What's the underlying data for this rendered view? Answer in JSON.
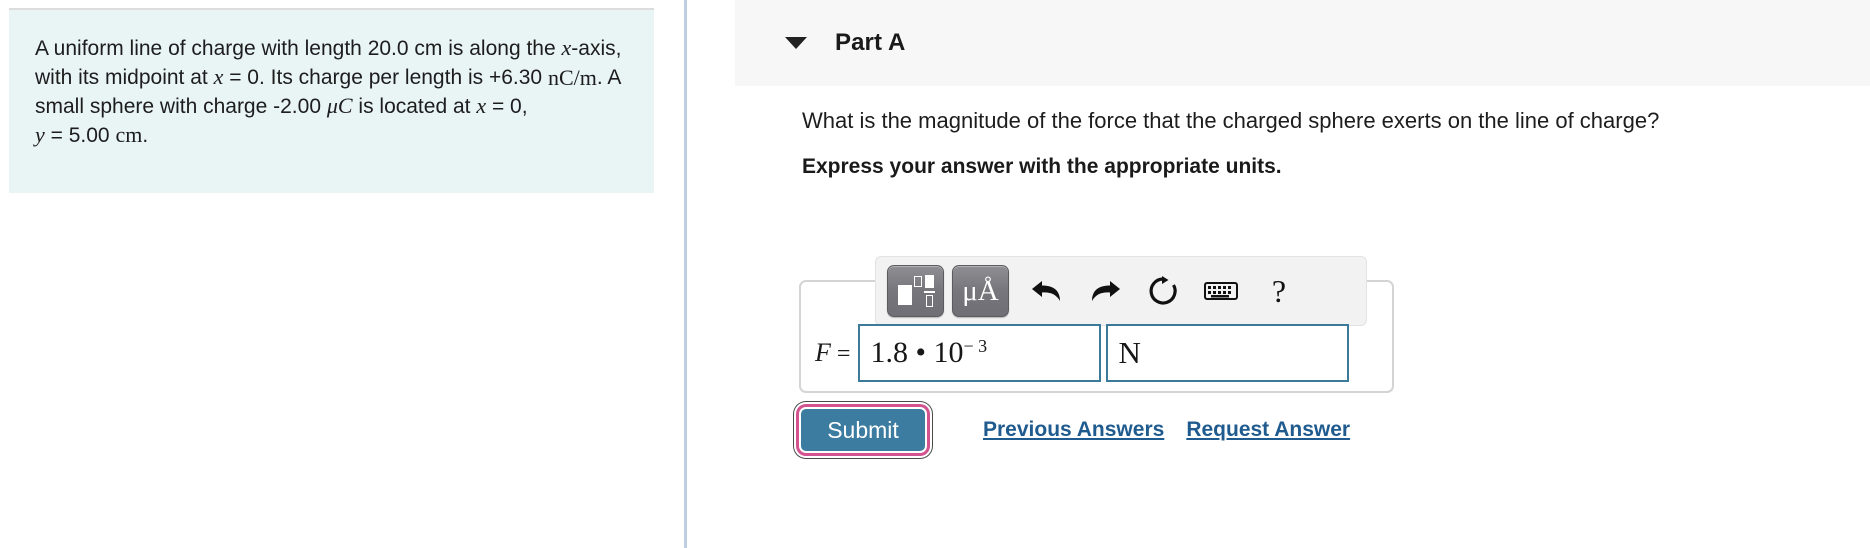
{
  "problem": {
    "segments": [
      {
        "t": "text",
        "v": "A uniform line of charge with length 20.0 cm is along the "
      },
      {
        "t": "math_i",
        "v": "x"
      },
      {
        "t": "text",
        "v": "-axis, with its midpoint at "
      },
      {
        "t": "math_i",
        "v": "x"
      },
      {
        "t": "text",
        "v": " = 0. Its charge per length is +6.30 "
      },
      {
        "t": "math_r",
        "v": "nC/m"
      },
      {
        "t": "text",
        "v": ". A small sphere with charge -2.00 "
      },
      {
        "t": "math_r",
        "v": "μC"
      },
      {
        "t": "text",
        "v": " is located at "
      },
      {
        "t": "math_i",
        "v": "x"
      },
      {
        "t": "text",
        "v": " = 0, "
      },
      {
        "t": "math_i",
        "v": "y"
      },
      {
        "t": "text",
        "v": " = 5.00 "
      },
      {
        "t": "math_r",
        "v": "cm"
      },
      {
        "t": "text",
        "v": "."
      }
    ],
    "plain": "A uniform line of charge with length 20.0 cm is along the x-axis, with its midpoint at x = 0. Its charge per length is +6.30 nC/m. A small sphere with charge -2.00 μC is located at x = 0, y = 5.00 cm.",
    "line1_a": "A uniform line of charge with length 20.0 cm",
    "line1_b": "is",
    "line2_a": "along the",
    "line2_x": "x",
    "line2_b": "-axis, with its midpoint at",
    "line2_x2": "x",
    "line2_c": "= 0. Its",
    "line3_a": "charge per length is +6.30",
    "line3_units": "nC/m",
    "line3_b": ". A small sphere",
    "line4_a": "with charge -2.00",
    "line4_units": "μC",
    "line4_b": "is located at",
    "line4_x": "x",
    "line4_c": "= 0,",
    "line5_y": "y",
    "line5_a": "= 5.00",
    "line5_units": "cm",
    "line5_b": "."
  },
  "part": {
    "title": "Part A",
    "collapse_icon": "caret-down-icon",
    "expanded": true
  },
  "question": {
    "prompt": "What is the magnitude of the force that the charged sphere exerts on the line of charge?",
    "instruction": "Express your answer with the appropriate units."
  },
  "toolbar": {
    "buttons": [
      {
        "name": "math-template-button",
        "icon": "math-template-icon",
        "label": "",
        "active": true
      },
      {
        "name": "units-button",
        "icon": "micro-angstrom-icon",
        "label": "μÅ",
        "active": true
      },
      {
        "name": "undo-button",
        "icon": "undo-arrow-icon",
        "label": ""
      },
      {
        "name": "redo-button",
        "icon": "redo-arrow-icon",
        "label": ""
      },
      {
        "name": "reset-button",
        "icon": "reset-circular-arrow-icon",
        "label": ""
      },
      {
        "name": "keyboard-button",
        "icon": "keyboard-icon",
        "label": ""
      },
      {
        "name": "help-button",
        "icon": "question-mark-icon",
        "label": "?"
      }
    ],
    "units_label": "μÅ",
    "help_label": "?"
  },
  "answer": {
    "variable": "F",
    "equals": "=",
    "value_mantissa": "1.8",
    "value_operator": "•",
    "value_base": "10",
    "value_exponent": "− 3",
    "value_display": "1.8 • 10−3",
    "units_value": "N",
    "value_placeholder": "",
    "units_placeholder": ""
  },
  "actions": {
    "submit_label": "Submit",
    "previous_answers_label": "Previous Answers",
    "request_answer_label": "Request Answer"
  },
  "colors": {
    "problem_box_bg": "#e9f4f5",
    "part_header_bg": "#f7f7f7",
    "divider": "#bed0e0",
    "input_border": "#3b7a99",
    "submit_bg": "#3b7ca0",
    "submit_focus_ring": "#d2538f",
    "link": "#1f5b8f",
    "toolbar_bg": "#f2f2f2",
    "toolbar_button": "#76767c"
  }
}
